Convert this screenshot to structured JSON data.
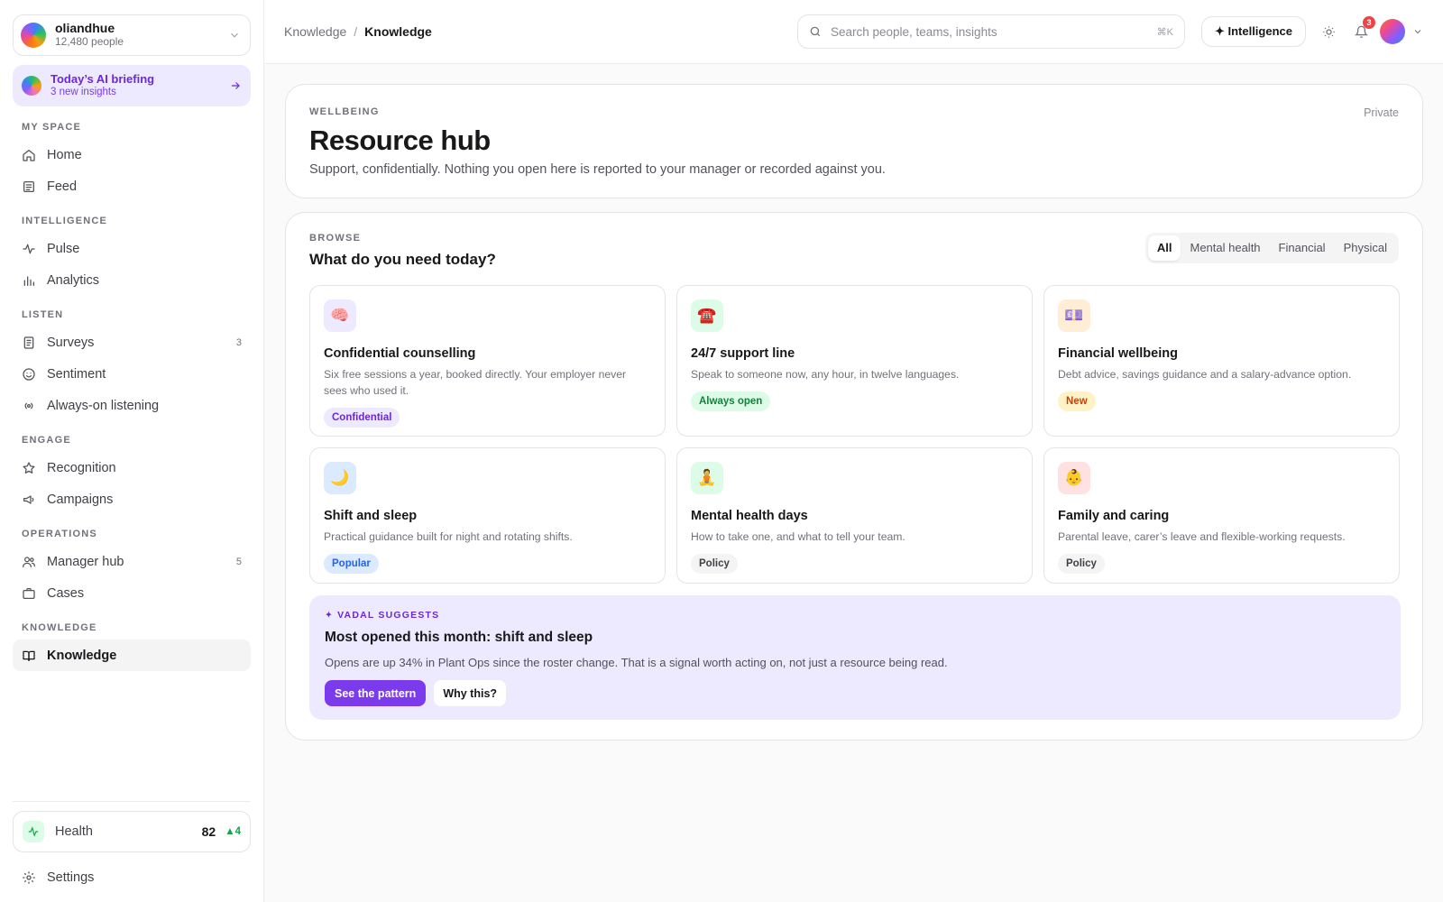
{
  "org": {
    "name": "oliandhue",
    "subtitle": "12,480 people"
  },
  "briefing": {
    "title": "Today’s AI briefing",
    "subtitle": "3 new insights"
  },
  "sidebar": {
    "sections": [
      {
        "label": "MY SPACE",
        "items": [
          {
            "label": "Home",
            "icon": "home-icon"
          },
          {
            "label": "Feed",
            "icon": "feed-icon"
          }
        ]
      },
      {
        "label": "INTELLIGENCE",
        "items": [
          {
            "label": "Pulse",
            "icon": "pulse-icon"
          },
          {
            "label": "Analytics",
            "icon": "bar-chart-icon"
          }
        ]
      },
      {
        "label": "LISTEN",
        "items": [
          {
            "label": "Surveys",
            "icon": "survey-icon",
            "badge": "3"
          },
          {
            "label": "Sentiment",
            "icon": "smile-icon"
          },
          {
            "label": "Always-on listening",
            "icon": "broadcast-icon"
          }
        ]
      },
      {
        "label": "ENGAGE",
        "items": [
          {
            "label": "Recognition",
            "icon": "star-icon"
          },
          {
            "label": "Campaigns",
            "icon": "megaphone-icon"
          }
        ]
      },
      {
        "label": "OPERATIONS",
        "items": [
          {
            "label": "Manager hub",
            "icon": "users-icon",
            "badge": "5"
          },
          {
            "label": "Cases",
            "icon": "briefcase-icon"
          }
        ]
      },
      {
        "label": "KNOWLEDGE",
        "items": [
          {
            "label": "Knowledge",
            "icon": "book-icon",
            "active": true
          }
        ]
      }
    ],
    "health": {
      "label": "Health",
      "value": "82",
      "delta": "▲4"
    },
    "settings_label": "Settings"
  },
  "header": {
    "breadcrumb": [
      "Knowledge",
      "Knowledge"
    ],
    "search_placeholder": "Search people, teams, insights",
    "search_shortcut": "⌘K",
    "intelligence_label": "✦ Intelligence",
    "notification_count": "3"
  },
  "hero": {
    "eyebrow": "WELLBEING",
    "title": "Resource hub",
    "description": "Support, confidentially. Nothing you open here is reported to your manager or recorded against you.",
    "visibility": "Private"
  },
  "browse": {
    "eyebrow": "BROWSE",
    "title": "What do you need today?",
    "tabs": [
      {
        "label": "All",
        "active": true
      },
      {
        "label": "Mental health"
      },
      {
        "label": "Financial"
      },
      {
        "label": "Physical"
      }
    ],
    "cards": [
      {
        "icon": "🧠",
        "icon_name": "brain-icon",
        "icon_bg": "#ede9fe",
        "title": "Confidential counselling",
        "description": "Six free sessions a year, booked directly. Your employer never sees who used it.",
        "tag": "Confidential",
        "tag_color": "#6d28d9",
        "tag_bg": "#ede9fe"
      },
      {
        "icon": "☎️",
        "icon_name": "phone-icon",
        "icon_bg": "#dcfce7",
        "title": "24/7 support line",
        "description": "Speak to someone now, any hour, in twelve languages.",
        "tag": "Always open",
        "tag_color": "#15803d",
        "tag_bg": "#dcfce7"
      },
      {
        "icon": "💷",
        "icon_name": "money-icon",
        "icon_bg": "#ffedd5",
        "title": "Financial wellbeing",
        "description": "Debt advice, savings guidance and a salary-advance option.",
        "tag": "New",
        "tag_color": "#c2410c",
        "tag_bg": "#fef3c7"
      },
      {
        "icon": "🌙",
        "icon_name": "moon-icon",
        "icon_bg": "#dbeafe",
        "title": "Shift and sleep",
        "description": "Practical guidance built for night and rotating shifts.",
        "tag": "Popular",
        "tag_color": "#2563eb",
        "tag_bg": "#dbeafe"
      },
      {
        "icon": "🧘",
        "icon_name": "meditation-icon",
        "icon_bg": "#dcfce7",
        "title": "Mental health days",
        "description": "How to take one, and what to tell your team.",
        "tag": "Policy",
        "tag_color": "#3f3f46",
        "tag_bg": "#f4f4f5"
      },
      {
        "icon": "👶",
        "icon_name": "baby-icon",
        "icon_bg": "#fee2e2",
        "title": "Family and caring",
        "description": "Parental leave, carer’s leave and flexible-working requests.",
        "tag": "Policy",
        "tag_color": "#3f3f46",
        "tag_bg": "#f4f4f5"
      }
    ]
  },
  "suggestion": {
    "eyebrow": "✦ VADAL SUGGESTS",
    "title": "Most opened this month: shift and sleep",
    "description": "Opens are up 34% in Plant Ops since the roster change. That is a signal worth acting on, not just a resource being read.",
    "primary_label": "See the pattern",
    "secondary_label": "Why this?"
  }
}
